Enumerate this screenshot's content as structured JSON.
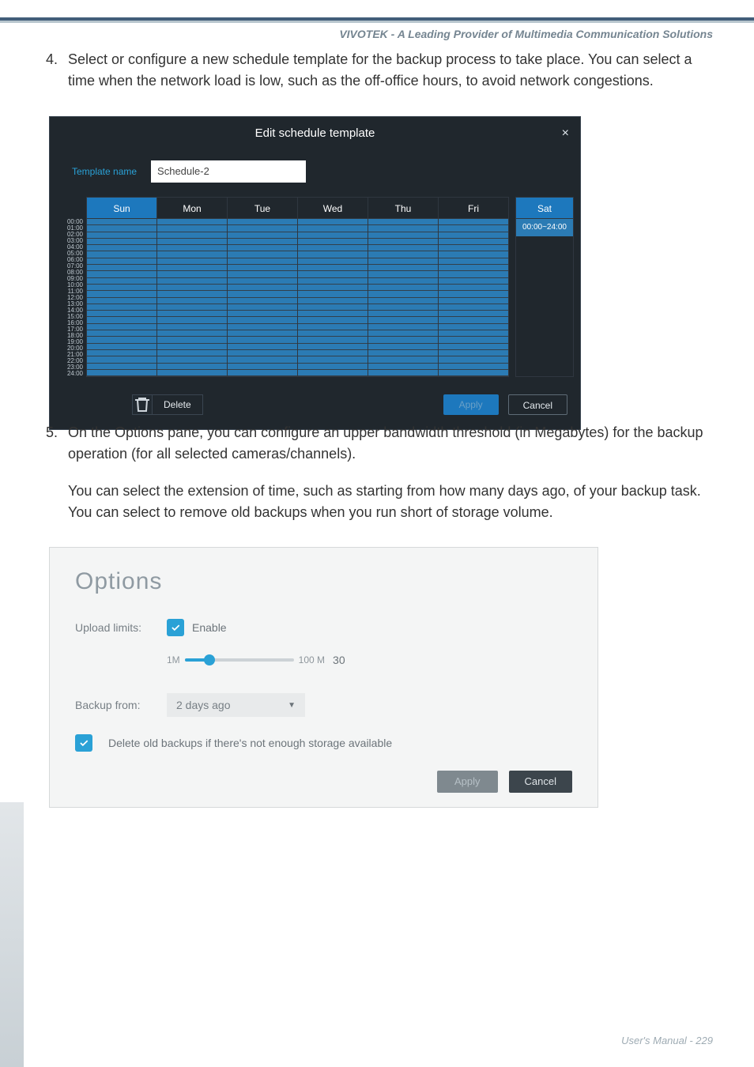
{
  "header": {
    "text": "VIVOTEK - A Leading Provider of Multimedia Communication Solutions"
  },
  "step4": {
    "num": "4.",
    "text": "Select or configure a new schedule template for the backup process to take place. You can select a time when the network load is low, such as the off-office hours, to avoid network congestions."
  },
  "dialog1": {
    "title": "Edit schedule template",
    "close": "×",
    "template_label": "Template name",
    "template_value": "Schedule-2",
    "days": [
      "Sun",
      "Mon",
      "Tue",
      "Wed",
      "Thu",
      "Fri"
    ],
    "side_head": "Sat",
    "side_item": "00:00~24:00",
    "hours": [
      "00:00",
      "01:00",
      "02:00",
      "03:00",
      "04:00",
      "05:00",
      "06:00",
      "07:00",
      "08:00",
      "09:00",
      "10:00",
      "11:00",
      "12:00",
      "13:00",
      "14:00",
      "15:00",
      "16:00",
      "17:00",
      "18:00",
      "19:00",
      "20:00",
      "21:00",
      "22:00",
      "23:00",
      "24:00"
    ],
    "delete": "Delete",
    "apply": "Apply",
    "cancel": "Cancel"
  },
  "step5": {
    "num": "5.",
    "p1": "On the Options pane, you can configure an upper bandwidth threshold (in Megabytes) for the backup operation (for all selected cameras/channels).",
    "p2": "You can select the extension of time, such as starting from how many days ago, of your backup task. You can select to remove old backups when you run short of storage volume."
  },
  "options": {
    "title": "Options",
    "upload_label": "Upload limits:",
    "enable": "Enable",
    "slider_min": "1M",
    "slider_max": "100 M",
    "slider_val": "30",
    "backup_label": "Backup from:",
    "backup_val": "2 days ago",
    "delete_label": "Delete old backups if there's not enough storage available",
    "apply": "Apply",
    "cancel": "Cancel"
  },
  "footer": {
    "text": "User's Manual - 229"
  }
}
